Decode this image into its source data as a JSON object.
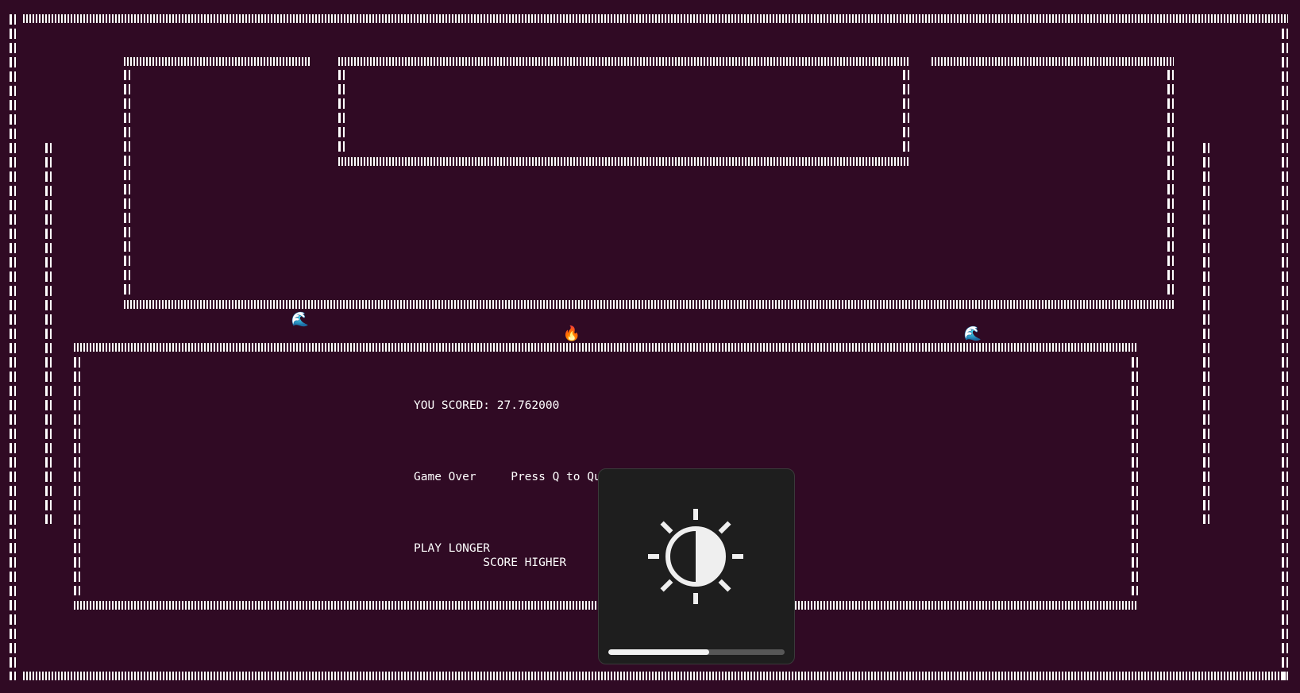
{
  "game": {
    "score_text": "YOU SCORED: 27.762000",
    "game_over_text": "Game Over     Press Q to Quit",
    "tagline_line1": "PLAY LONGER",
    "tagline_line2": "          SCORE HIGHER"
  },
  "sprites": [
    {
      "name": "wave-enemy-icon",
      "glyph": "🌊",
      "color": "#5ab4e6"
    },
    {
      "name": "fire-player-icon",
      "glyph": "🔥",
      "color": "#ff8c1a"
    },
    {
      "name": "wave-enemy-icon",
      "glyph": "🌊",
      "color": "#5ab4e6"
    }
  ],
  "brightness_osd": {
    "icon": "brightness-icon",
    "level": 0.57
  },
  "colors": {
    "background": "#300a24",
    "wall": "#ffffff",
    "osd_background": "#1e1e1e",
    "osd_fill": "#f2f2f2",
    "osd_track": "#575757"
  }
}
